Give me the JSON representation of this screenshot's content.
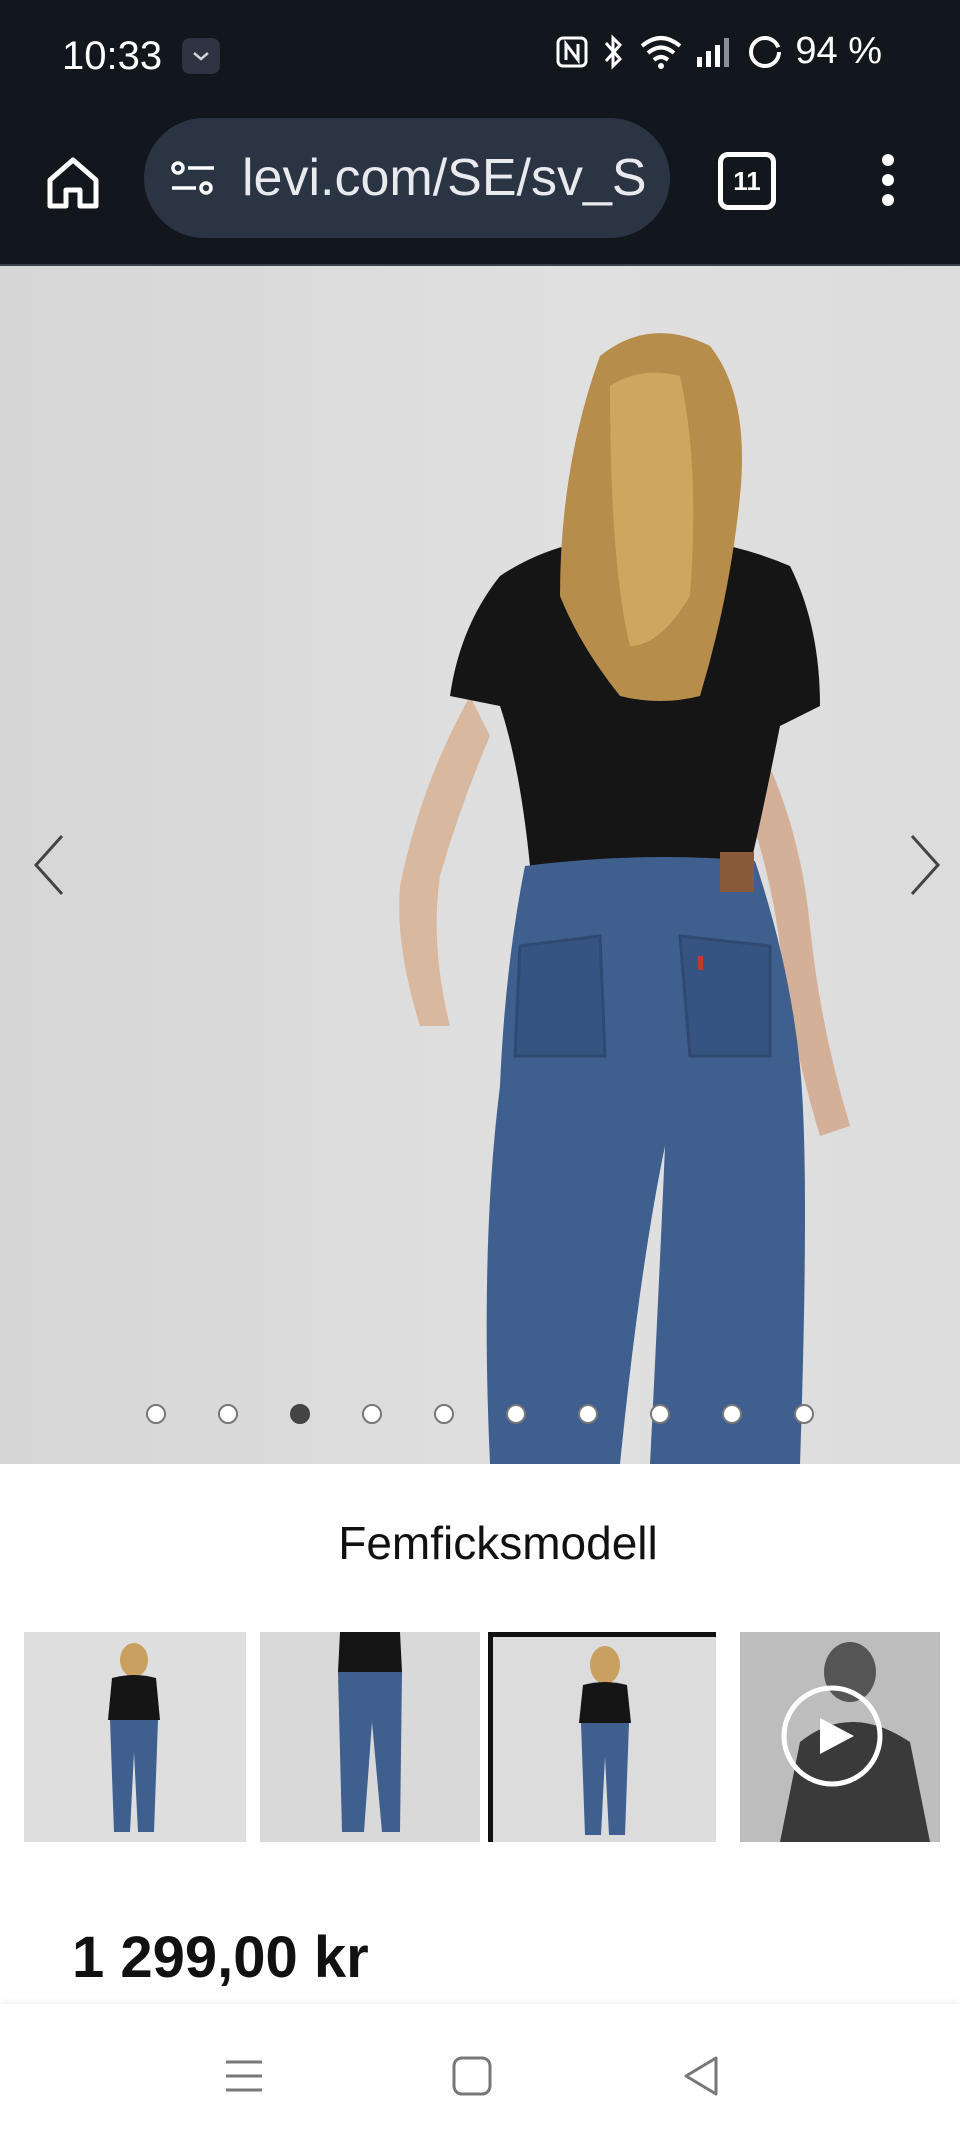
{
  "status_bar": {
    "time": "10:33",
    "battery": "94 %",
    "icons": [
      "mail-notification-icon",
      "nfc-icon",
      "bluetooth-icon",
      "wifi-icon",
      "signal-icon",
      "battery-icon"
    ]
  },
  "browser": {
    "url": "levi.com/SE/sv_S",
    "tab_count": "11",
    "icons": [
      "home-icon",
      "tune-icon",
      "more-vert-icon"
    ]
  },
  "gallery": {
    "image_count": 10,
    "active_index": 2,
    "icons": [
      "chevron-left-icon",
      "chevron-right-icon",
      "play-icon"
    ]
  },
  "product": {
    "title": "Femficksmodell",
    "price": "1 299,00 kr"
  },
  "nav_bar": {
    "icons": [
      "recents-icon",
      "home-nav-icon",
      "back-icon"
    ]
  },
  "colors": {
    "dark_bar": "#12161d",
    "omnibox": "#2b3442",
    "denim": "#3f5f8f",
    "shirt": "#151515"
  }
}
